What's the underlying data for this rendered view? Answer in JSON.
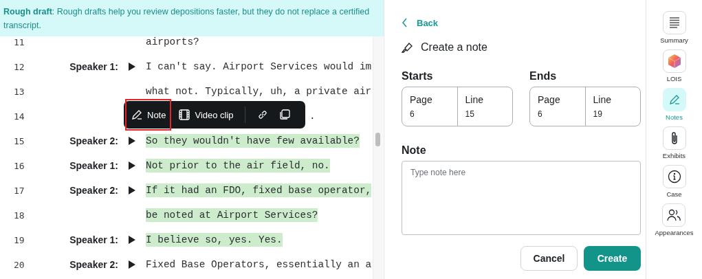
{
  "banner": {
    "title": "Rough draft",
    "text": ": Rough drafts help you review depositions faster, but they do not replace a certified transcript."
  },
  "transcript": [
    {
      "line": "11",
      "text": "airports?",
      "highlighted": false,
      "kind": "full"
    },
    {
      "line": "12",
      "speaker": "Speaker 1:",
      "text": "I can't say. Airport Services would im",
      "highlighted": false,
      "kind": "full"
    },
    {
      "line": "13",
      "text": "what not. Typically, uh, a private air",
      "highlighted": false,
      "kind": "full"
    },
    {
      "line": "14",
      "text": ".",
      "highlighted": false,
      "kind": "tail"
    },
    {
      "line": "15",
      "speaker": "Speaker 2:",
      "text": "So they wouldn't have few available?",
      "highlighted": true,
      "kind": "full"
    },
    {
      "line": "16",
      "speaker": "Speaker 1:",
      "text": "Not prior to the air field, no.",
      "highlighted": true,
      "kind": "full"
    },
    {
      "line": "17",
      "speaker": "Speaker 2:",
      "text": "If it had an FDO, fixed base operator,",
      "highlighted": true,
      "kind": "full"
    },
    {
      "line": "18",
      "text": "be noted at Airport Services?",
      "highlighted": true,
      "kind": "full"
    },
    {
      "line": "19",
      "speaker": "Speaker 1:",
      "text": "I believe so, yes. Yes.",
      "highlighted": true,
      "kind": "full"
    },
    {
      "line": "20",
      "speaker": "Speaker 2:",
      "text": "Fixed Base Operators, essentially an a",
      "highlighted": false,
      "kind": "full"
    }
  ],
  "toolbar": {
    "note": {
      "label": "Note",
      "selected": true
    },
    "video_clip": "Video clip"
  },
  "panel": {
    "back": "Back",
    "title": "Create a note",
    "ranges": [
      {
        "label": "Starts",
        "page_label": "Page",
        "page": "6",
        "line_label": "Line",
        "line": "15"
      },
      {
        "label": "Ends",
        "page_label": "Page",
        "page": "6",
        "line_label": "Line",
        "line": "19"
      }
    ],
    "note_label": "Note",
    "note_placeholder": "Type note here",
    "cancel": "Cancel",
    "create": "Create"
  },
  "sidebar": [
    {
      "kind": "summary",
      "label": "Summary",
      "selected": false
    },
    {
      "kind": "lois",
      "label": "LOIS",
      "selected": false
    },
    {
      "kind": "notes",
      "label": "Notes",
      "selected": true
    },
    {
      "kind": "exhibits",
      "label": "Exhibits",
      "selected": false
    },
    {
      "kind": "case",
      "label": "Case",
      "selected": false
    },
    {
      "kind": "appearances",
      "label": "Appearances",
      "selected": false
    }
  ]
}
